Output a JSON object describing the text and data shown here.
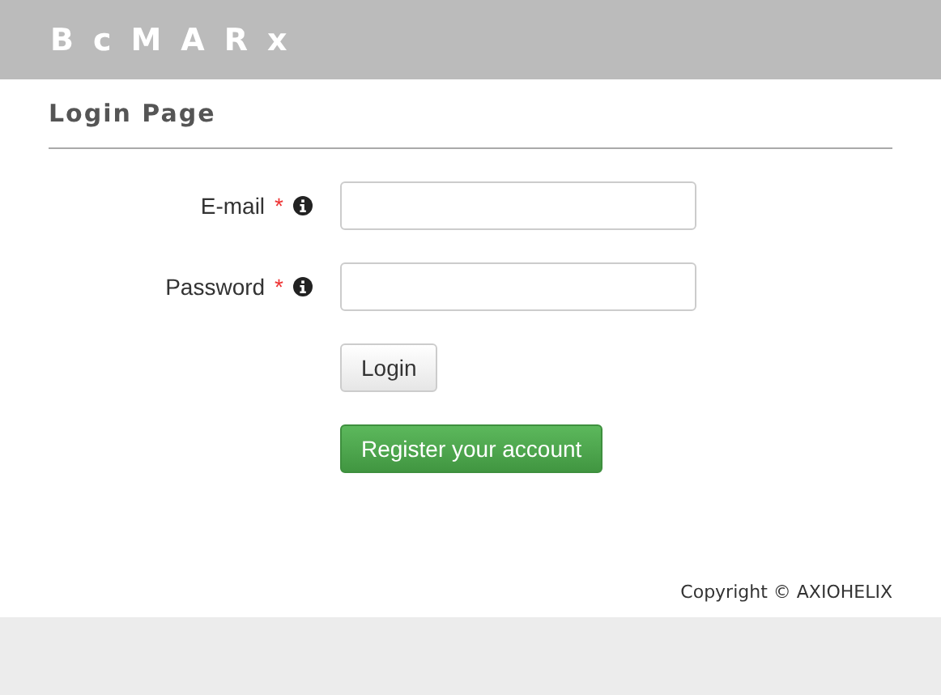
{
  "header": {
    "logo": "BcMARx"
  },
  "page_title": "Login Page",
  "fields": [
    {
      "label": "E-mail",
      "required_mark": "*",
      "info": true
    },
    {
      "label": "Password",
      "required_mark": "*",
      "info": true
    }
  ],
  "buttons": [
    {
      "label": "Login",
      "kind": "default"
    },
    {
      "label": "Register your account",
      "kind": "success"
    }
  ],
  "footer": {
    "copyright": "Copyright © AXIOHELIX"
  }
}
